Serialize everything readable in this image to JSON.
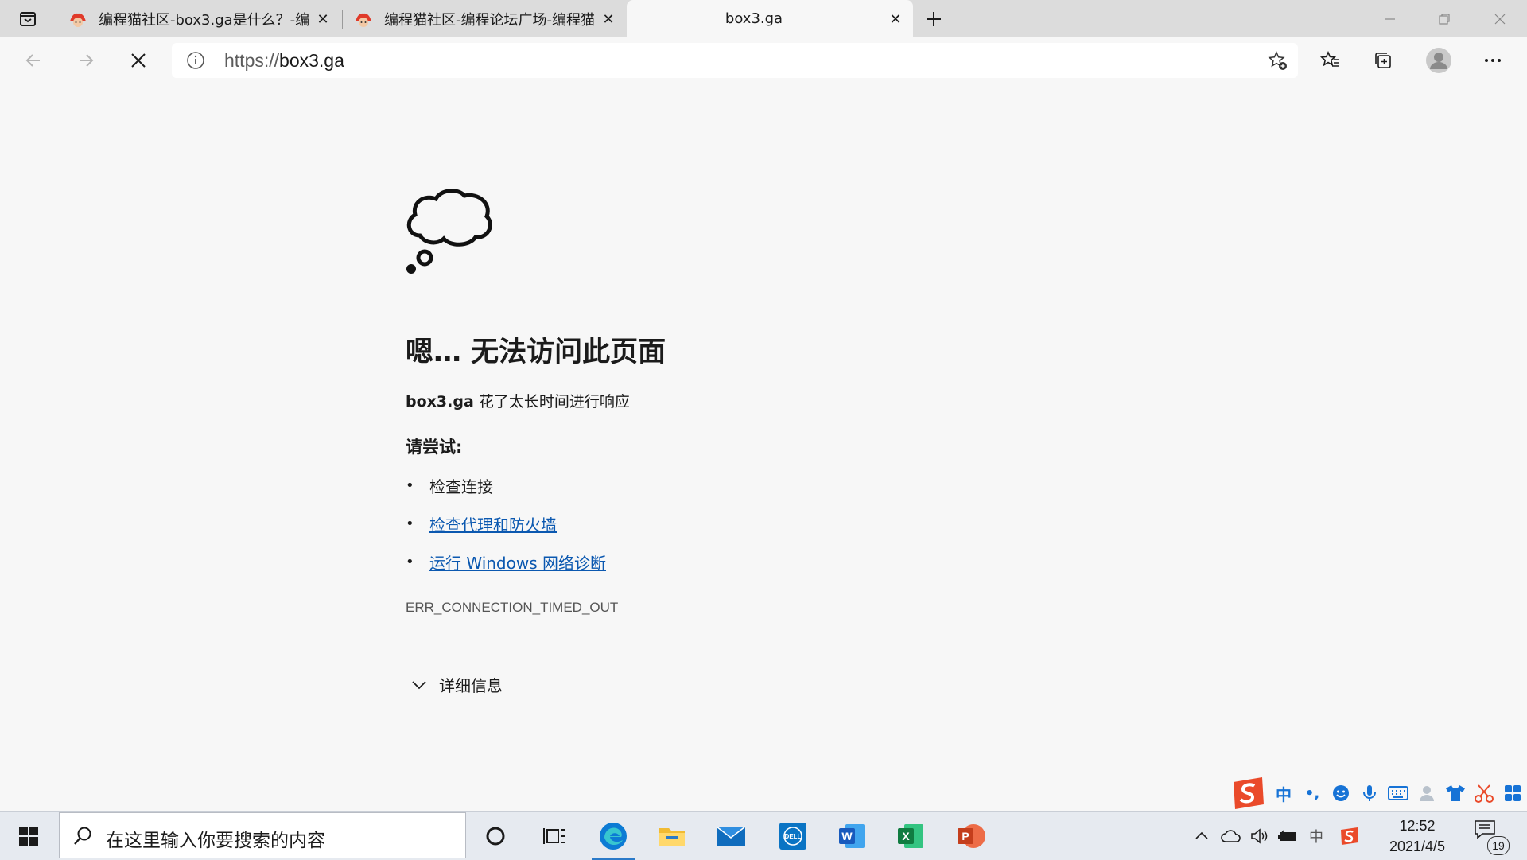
{
  "tabs": [
    {
      "title": "编程猫社区-box3.ga是什么？-编",
      "has_close": true
    },
    {
      "title": "编程猫社区-编程论坛广场-编程猫",
      "has_close": true
    },
    {
      "title": "box3.ga",
      "has_close": true,
      "active": true
    }
  ],
  "omnibox": {
    "url_protocol": "https://",
    "url_host": "box3.ga"
  },
  "error_page": {
    "title": "嗯… 无法访问此页面",
    "host": "box3.ga",
    "description": " 花了太长时间进行响应",
    "try_label": "请尝试:",
    "suggestions": [
      {
        "text": "检查连接",
        "is_link": false
      },
      {
        "text": "检查代理和防火墙",
        "is_link": true
      },
      {
        "text": "运行 Windows 网络诊断",
        "is_link": true
      }
    ],
    "error_code": "ERR_CONNECTION_TIMED_OUT",
    "details_label": "详细信息"
  },
  "ime_toolbar": {
    "mode_label": "中",
    "punct_label": "•,"
  },
  "taskbar": {
    "search_placeholder": "在这里输入你要搜索的内容",
    "ime_indicator": "中",
    "time": "12:52",
    "date": "2021/4/5",
    "notification_count": "19"
  },
  "colors": {
    "link": "#0b58b0",
    "edge_blue": "#0c7bd4",
    "word_blue": "#185abd",
    "excel_green": "#107c41",
    "ppt_red": "#c43e1c",
    "sogou_red": "#ea4a2a"
  }
}
